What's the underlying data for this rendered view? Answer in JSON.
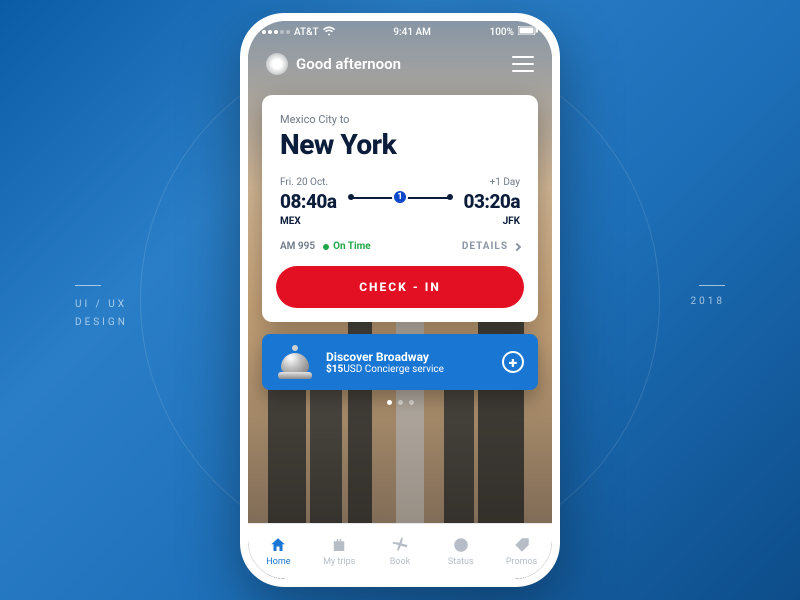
{
  "deco": {
    "left_line1": "UI / UX",
    "left_line2": "DESIGN",
    "right": "2018"
  },
  "statusbar": {
    "carrier": "AT&T",
    "time": "9:41 AM",
    "battery": "100%"
  },
  "header": {
    "greeting": "Good afternoon"
  },
  "trip": {
    "origin_line": "Mexico City to",
    "destination": "New York",
    "depart": {
      "date": "Fri. 20 Oct.",
      "time": "08:40a",
      "code": "MEX"
    },
    "stops": "1",
    "arrive": {
      "date": "+1 Day",
      "time": "03:20a",
      "code": "JFK"
    },
    "flight_no": "AM 995",
    "status": "On Time",
    "details_label": "DETAILS",
    "checkin_label": "CHECK - IN"
  },
  "promo": {
    "title": "Discover Broadway",
    "price": "$15",
    "currency": "USD",
    "subtitle": " Concierge service"
  },
  "tabs": [
    {
      "label": "Home"
    },
    {
      "label": "My trips"
    },
    {
      "label": "Book"
    },
    {
      "label": "Status"
    },
    {
      "label": "Promos"
    }
  ]
}
